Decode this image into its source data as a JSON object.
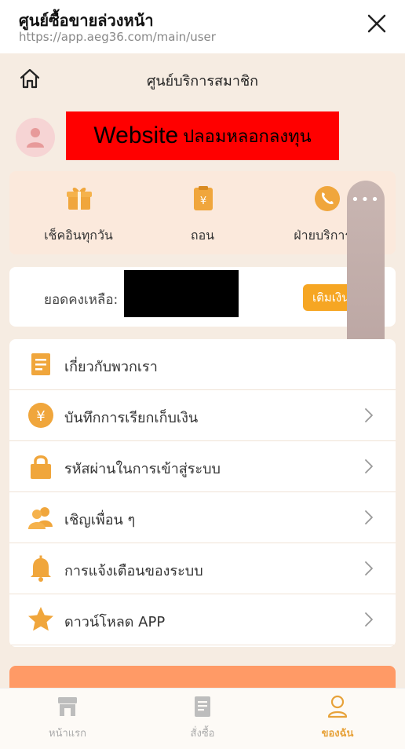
{
  "browser": {
    "title": "ศูนย์ซื้อขายล่วงหน้า",
    "url": "https://app.aeg36.com/main/user"
  },
  "header": {
    "title": "ศูนย์บริการสมาชิก"
  },
  "profile": {
    "warning_main": "Website",
    "warning_sub": "ปลอมหลอกลงทุน"
  },
  "quick_actions": [
    {
      "label": "เช็คอินทุกวัน",
      "icon": "gift-icon"
    },
    {
      "label": "ถอน",
      "icon": "withdraw-icon"
    },
    {
      "label": "ฝ่ายบริการลู",
      "icon": "phone-icon"
    }
  ],
  "balance": {
    "label": "ยอดคงเหลือ:",
    "topup_label": "เติมเงิน"
  },
  "menu": [
    {
      "label": "เกี่ยวกับพวกเรา",
      "icon": "document-icon"
    },
    {
      "label": "บันทึกการเรียกเก็บเงิน",
      "icon": "yen-icon"
    },
    {
      "label": "รหัสผ่านในการเข้าสู่ระบบ",
      "icon": "lock-icon"
    },
    {
      "label": "เชิญเพื่อน ๆ",
      "icon": "users-icon"
    },
    {
      "label": "การแจ้งเตือนของระบบ",
      "icon": "bell-icon"
    },
    {
      "label": "ดาวน์โหลด APP",
      "icon": "star-icon"
    }
  ],
  "tabs": [
    {
      "label": "หน้าแรก",
      "icon": "store-icon",
      "active": false
    },
    {
      "label": "สั่งซื้อ",
      "icon": "orders-icon",
      "active": false
    },
    {
      "label": "ของฉัน",
      "icon": "user-icon",
      "active": true
    }
  ],
  "colors": {
    "accent": "#f6a623",
    "tab_active": "#e7a23a",
    "background": "#f6ece2",
    "warning": "#ff0000"
  }
}
